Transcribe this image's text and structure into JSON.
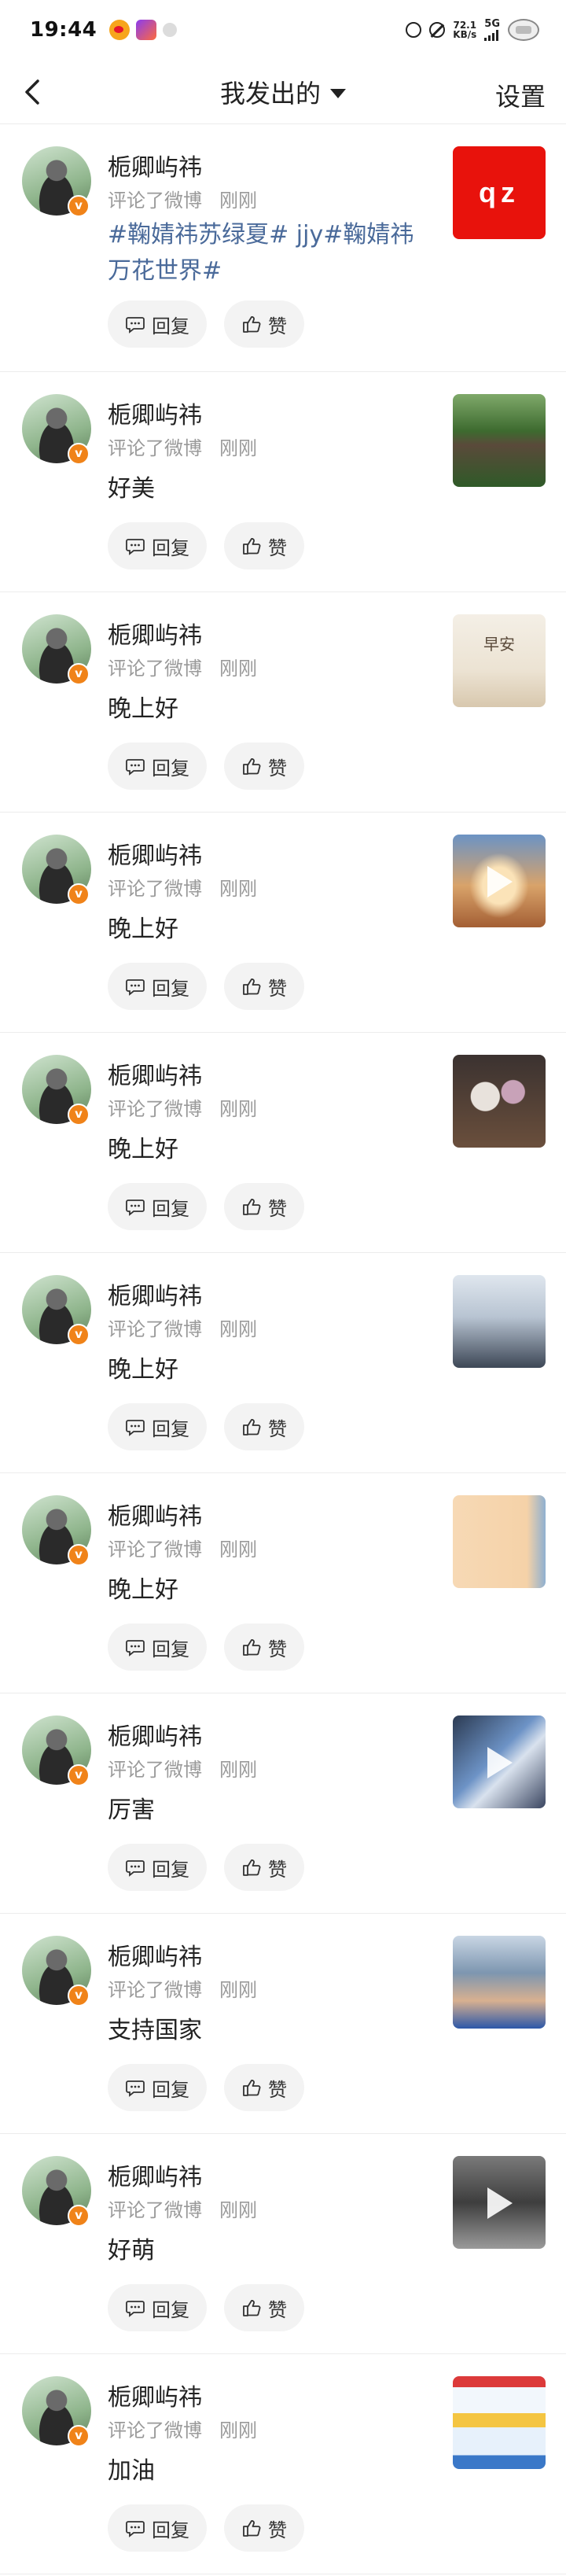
{
  "status_bar": {
    "time": "19:44",
    "net_speed_value": "72.1",
    "net_speed_unit": "KB/s",
    "network": "5G"
  },
  "nav": {
    "title": "我发出的",
    "settings": "设置"
  },
  "comments": [
    {
      "user": "栀卿屿祎",
      "action": "评论了微博",
      "time": "刚刚",
      "text": "#鞠婧祎苏绿夏# jjy#鞠婧祎万花世界#",
      "reply": "回复",
      "like": "赞",
      "thumb": {
        "kind": "qz",
        "text": "qz",
        "bg": "#e8120c",
        "video": false
      }
    },
    {
      "user": "栀卿屿祎",
      "action": "评论了微博",
      "time": "刚刚",
      "text": "好美",
      "reply": "回复",
      "like": "赞",
      "thumb": {
        "kind": "garden",
        "bg": "#4a7a3a",
        "video": false
      }
    },
    {
      "user": "栀卿屿祎",
      "action": "评论了微博",
      "time": "刚刚",
      "text": "晚上好",
      "reply": "回复",
      "like": "赞",
      "thumb": {
        "kind": "morning",
        "text": "早安",
        "bg": "#f1ebe1",
        "video": false
      }
    },
    {
      "user": "栀卿屿祎",
      "action": "评论了微博",
      "time": "刚刚",
      "text": "晚上好",
      "reply": "回复",
      "like": "赞",
      "thumb": {
        "kind": "sky",
        "bg": "#c98d56",
        "video": true
      }
    },
    {
      "user": "栀卿屿祎",
      "action": "评论了微博",
      "time": "刚刚",
      "text": "晚上好",
      "reply": "回复",
      "like": "赞",
      "thumb": {
        "kind": "flowers",
        "bg": "#3a2e2a",
        "video": false
      }
    },
    {
      "user": "栀卿屿祎",
      "action": "评论了微博",
      "time": "刚刚",
      "text": "晚上好",
      "reply": "回复",
      "like": "赞",
      "thumb": {
        "kind": "meeting",
        "bg": "#9aa7b8",
        "video": false
      }
    },
    {
      "user": "栀卿屿祎",
      "action": "评论了微博",
      "time": "刚刚",
      "text": "晚上好",
      "reply": "回复",
      "like": "赞",
      "thumb": {
        "kind": "peach",
        "bg": "#f7d9b5",
        "video": false
      }
    },
    {
      "user": "栀卿屿祎",
      "action": "评论了微博",
      "time": "刚刚",
      "text": "厉害",
      "reply": "回复",
      "like": "赞",
      "thumb": {
        "kind": "blue",
        "bg": "#4a5a70",
        "video": true
      }
    },
    {
      "user": "栀卿屿祎",
      "action": "评论了微博",
      "time": "刚刚",
      "text": "支持国家",
      "reply": "回复",
      "like": "赞",
      "thumb": {
        "kind": "news",
        "bg": "#6d8aa8",
        "video": false
      }
    },
    {
      "user": "栀卿屿祎",
      "action": "评论了微博",
      "time": "刚刚",
      "text": "好萌",
      "reply": "回复",
      "like": "赞",
      "thumb": {
        "kind": "grey",
        "bg": "#5c5c5c",
        "video": true
      }
    },
    {
      "user": "栀卿屿祎",
      "action": "评论了微博",
      "time": "刚刚",
      "text": "加油",
      "reply": "回复",
      "like": "赞",
      "thumb": {
        "kind": "poster",
        "bg": "#e9f2fb",
        "video": false
      }
    }
  ]
}
